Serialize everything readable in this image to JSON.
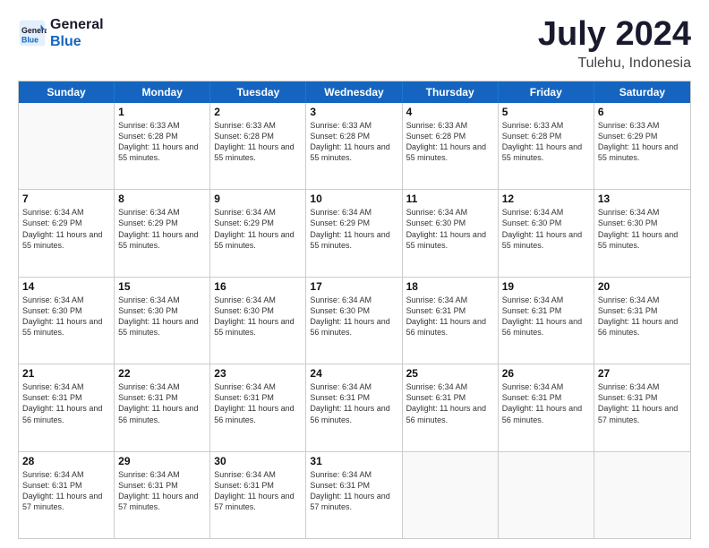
{
  "logo": {
    "line1": "General",
    "line2": "Blue"
  },
  "title": "July 2024",
  "subtitle": "Tulehu, Indonesia",
  "days_of_week": [
    "Sunday",
    "Monday",
    "Tuesday",
    "Wednesday",
    "Thursday",
    "Friday",
    "Saturday"
  ],
  "weeks": [
    [
      {
        "day": "",
        "empty": true
      },
      {
        "day": "1",
        "sunrise": "6:33 AM",
        "sunset": "6:28 PM",
        "daylight": "11 hours and 55 minutes."
      },
      {
        "day": "2",
        "sunrise": "6:33 AM",
        "sunset": "6:28 PM",
        "daylight": "11 hours and 55 minutes."
      },
      {
        "day": "3",
        "sunrise": "6:33 AM",
        "sunset": "6:28 PM",
        "daylight": "11 hours and 55 minutes."
      },
      {
        "day": "4",
        "sunrise": "6:33 AM",
        "sunset": "6:28 PM",
        "daylight": "11 hours and 55 minutes."
      },
      {
        "day": "5",
        "sunrise": "6:33 AM",
        "sunset": "6:28 PM",
        "daylight": "11 hours and 55 minutes."
      },
      {
        "day": "6",
        "sunrise": "6:33 AM",
        "sunset": "6:29 PM",
        "daylight": "11 hours and 55 minutes."
      }
    ],
    [
      {
        "day": "7",
        "sunrise": "6:34 AM",
        "sunset": "6:29 PM",
        "daylight": "11 hours and 55 minutes."
      },
      {
        "day": "8",
        "sunrise": "6:34 AM",
        "sunset": "6:29 PM",
        "daylight": "11 hours and 55 minutes."
      },
      {
        "day": "9",
        "sunrise": "6:34 AM",
        "sunset": "6:29 PM",
        "daylight": "11 hours and 55 minutes."
      },
      {
        "day": "10",
        "sunrise": "6:34 AM",
        "sunset": "6:29 PM",
        "daylight": "11 hours and 55 minutes."
      },
      {
        "day": "11",
        "sunrise": "6:34 AM",
        "sunset": "6:30 PM",
        "daylight": "11 hours and 55 minutes."
      },
      {
        "day": "12",
        "sunrise": "6:34 AM",
        "sunset": "6:30 PM",
        "daylight": "11 hours and 55 minutes."
      },
      {
        "day": "13",
        "sunrise": "6:34 AM",
        "sunset": "6:30 PM",
        "daylight": "11 hours and 55 minutes."
      }
    ],
    [
      {
        "day": "14",
        "sunrise": "6:34 AM",
        "sunset": "6:30 PM",
        "daylight": "11 hours and 55 minutes."
      },
      {
        "day": "15",
        "sunrise": "6:34 AM",
        "sunset": "6:30 PM",
        "daylight": "11 hours and 55 minutes."
      },
      {
        "day": "16",
        "sunrise": "6:34 AM",
        "sunset": "6:30 PM",
        "daylight": "11 hours and 55 minutes."
      },
      {
        "day": "17",
        "sunrise": "6:34 AM",
        "sunset": "6:30 PM",
        "daylight": "11 hours and 56 minutes."
      },
      {
        "day": "18",
        "sunrise": "6:34 AM",
        "sunset": "6:31 PM",
        "daylight": "11 hours and 56 minutes."
      },
      {
        "day": "19",
        "sunrise": "6:34 AM",
        "sunset": "6:31 PM",
        "daylight": "11 hours and 56 minutes."
      },
      {
        "day": "20",
        "sunrise": "6:34 AM",
        "sunset": "6:31 PM",
        "daylight": "11 hours and 56 minutes."
      }
    ],
    [
      {
        "day": "21",
        "sunrise": "6:34 AM",
        "sunset": "6:31 PM",
        "daylight": "11 hours and 56 minutes."
      },
      {
        "day": "22",
        "sunrise": "6:34 AM",
        "sunset": "6:31 PM",
        "daylight": "11 hours and 56 minutes."
      },
      {
        "day": "23",
        "sunrise": "6:34 AM",
        "sunset": "6:31 PM",
        "daylight": "11 hours and 56 minutes."
      },
      {
        "day": "24",
        "sunrise": "6:34 AM",
        "sunset": "6:31 PM",
        "daylight": "11 hours and 56 minutes."
      },
      {
        "day": "25",
        "sunrise": "6:34 AM",
        "sunset": "6:31 PM",
        "daylight": "11 hours and 56 minutes."
      },
      {
        "day": "26",
        "sunrise": "6:34 AM",
        "sunset": "6:31 PM",
        "daylight": "11 hours and 56 minutes."
      },
      {
        "day": "27",
        "sunrise": "6:34 AM",
        "sunset": "6:31 PM",
        "daylight": "11 hours and 57 minutes."
      }
    ],
    [
      {
        "day": "28",
        "sunrise": "6:34 AM",
        "sunset": "6:31 PM",
        "daylight": "11 hours and 57 minutes."
      },
      {
        "day": "29",
        "sunrise": "6:34 AM",
        "sunset": "6:31 PM",
        "daylight": "11 hours and 57 minutes."
      },
      {
        "day": "30",
        "sunrise": "6:34 AM",
        "sunset": "6:31 PM",
        "daylight": "11 hours and 57 minutes."
      },
      {
        "day": "31",
        "sunrise": "6:34 AM",
        "sunset": "6:31 PM",
        "daylight": "11 hours and 57 minutes."
      },
      {
        "day": "",
        "empty": true
      },
      {
        "day": "",
        "empty": true
      },
      {
        "day": "",
        "empty": true
      }
    ]
  ]
}
